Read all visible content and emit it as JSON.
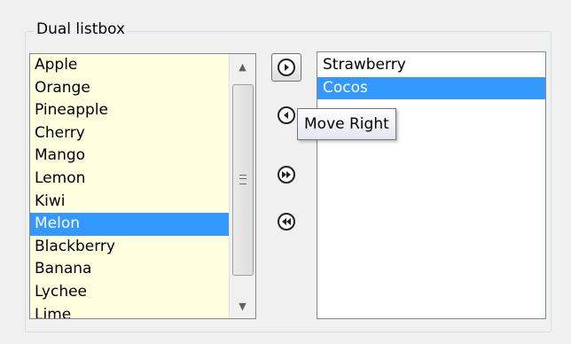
{
  "group": {
    "title": "Dual listbox"
  },
  "left_list": {
    "items": [
      "Apple",
      "Orange",
      "Pineapple",
      "Cherry",
      "Mango",
      "Lemon",
      "Kiwi",
      "Melon",
      "Blackberry",
      "Banana",
      "Lychee",
      "Lime"
    ],
    "selected": "Melon"
  },
  "right_list": {
    "items": [
      "Strawberry",
      "Cocos"
    ],
    "selected": "Cocos"
  },
  "buttons": {
    "move_right": "move-right-icon",
    "move_left": "move-left-icon",
    "move_all_right": "move-all-right-icon",
    "move_all_left": "move-all-left-icon"
  },
  "tooltip": {
    "text": "Move Right"
  },
  "scrollbar": {
    "up": "scroll-up-icon",
    "down": "scroll-down-icon"
  }
}
